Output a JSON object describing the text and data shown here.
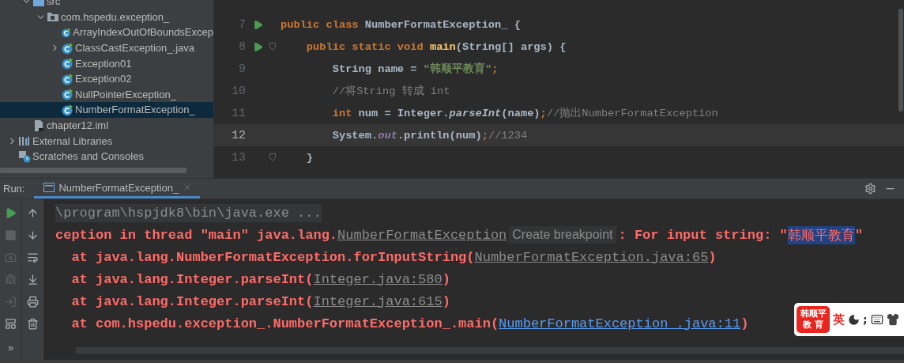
{
  "project_tree": {
    "module_items": [
      {
        "label": "src",
        "kind": "source-folder",
        "expanded": true,
        "children": [
          {
            "label": "com.hspedu.exception_",
            "kind": "package",
            "expanded": true,
            "children": [
              {
                "label": "ArrayIndexOutOfBoundsExcep",
                "kind": "class",
                "selected": false
              },
              {
                "label": "ClassCastException_.java",
                "kind": "class",
                "expanded": false,
                "selected": false
              },
              {
                "label": "Exception01",
                "kind": "class",
                "selected": false
              },
              {
                "label": "Exception02",
                "kind": "class",
                "selected": false
              },
              {
                "label": "NullPointerException_",
                "kind": "class",
                "selected": false
              },
              {
                "label": "NumberFormatException_",
                "kind": "class",
                "selected": true
              }
            ]
          }
        ]
      },
      {
        "label": "chapter12.iml",
        "kind": "iml"
      }
    ],
    "root_items": [
      {
        "label": "External Libraries",
        "kind": "libraries",
        "expanded": false
      },
      {
        "label": "Scratches and Consoles",
        "kind": "scratches"
      }
    ]
  },
  "editor": {
    "lines": [
      {
        "number": "7",
        "run": true,
        "current": false,
        "tokens": [
          {
            "kind": "keyword",
            "text": "public class "
          },
          {
            "kind": "plain",
            "text": "NumberFormatException_ {"
          }
        ]
      },
      {
        "number": "8",
        "run": true,
        "fold": true,
        "current": false,
        "tokens": [
          {
            "kind": "keyword",
            "text": "    public static void "
          },
          {
            "kind": "method",
            "text": "main"
          },
          {
            "kind": "plain",
            "text": "(String[] args) {"
          }
        ]
      },
      {
        "number": "9",
        "current": false,
        "tokens": [
          {
            "kind": "plain",
            "text": "        String name = "
          },
          {
            "kind": "string",
            "text": "\"韩顺平教育\""
          },
          {
            "kind": "keyword",
            "text": ";"
          }
        ]
      },
      {
        "number": "10",
        "current": false,
        "tokens": [
          {
            "kind": "comment",
            "text": "        //将String 转成 int"
          }
        ]
      },
      {
        "number": "11",
        "current": false,
        "tokens": [
          {
            "kind": "keyword",
            "text": "        int "
          },
          {
            "kind": "plain",
            "text": "num = Integer."
          },
          {
            "kind": "static-call",
            "text": "parseInt"
          },
          {
            "kind": "plain",
            "text": "(name)"
          },
          {
            "kind": "keyword",
            "text": ";"
          },
          {
            "kind": "comment",
            "text": "//抛出NumberFormatException"
          }
        ]
      },
      {
        "number": "12",
        "current": true,
        "tokens": [
          {
            "kind": "plain",
            "text": "        System."
          },
          {
            "kind": "static-field",
            "text": "out"
          },
          {
            "kind": "plain",
            "text": ".println(num)"
          },
          {
            "kind": "keyword",
            "text": ";"
          },
          {
            "kind": "comment",
            "text": "//1234"
          }
        ]
      },
      {
        "number": "13",
        "fold": true,
        "current": false,
        "tokens": [
          {
            "kind": "plain",
            "text": "    }"
          }
        ]
      }
    ]
  },
  "run_panel": {
    "label": "Run:",
    "tab": {
      "label": "NumberFormatException_",
      "selected": true
    },
    "left_tools": [
      {
        "kind": "run",
        "disabled": false
      },
      {
        "kind": "stop",
        "disabled": true
      },
      {
        "kind": "camera",
        "disabled": true
      },
      {
        "kind": "debug",
        "disabled": true
      },
      {
        "kind": "enter",
        "disabled": true
      },
      {
        "kind": "layout",
        "disabled": false
      }
    ],
    "more_label": "»",
    "right_tools": [
      {
        "kind": "up"
      },
      {
        "kind": "down"
      },
      {
        "kind": "wrap"
      },
      {
        "kind": "scroll-end"
      },
      {
        "kind": "print"
      },
      {
        "kind": "trash"
      }
    ],
    "console": [
      {
        "kind": "command",
        "segments": [
          {
            "kind": "text",
            "text": "\\program\\hspjdk8\\bin\\java.exe ..."
          }
        ]
      },
      {
        "kind": "error",
        "segments": [
          {
            "kind": "text",
            "text": "ception in thread \"main\" java.lang."
          },
          {
            "kind": "link",
            "text": "NumberFormatException"
          },
          {
            "kind": "hint",
            "text": "Create breakpoint"
          },
          {
            "kind": "text",
            "text": ": For input string: \""
          },
          {
            "kind": "selection",
            "text": "韩顺平教育"
          },
          {
            "kind": "text",
            "text": "\""
          }
        ]
      },
      {
        "kind": "error",
        "segments": [
          {
            "kind": "text",
            "text": "  at java.lang.NumberFormatException.forInputString("
          },
          {
            "kind": "link",
            "text": "NumberFormatException.java:65"
          },
          {
            "kind": "text",
            "text": ")"
          }
        ]
      },
      {
        "kind": "error",
        "segments": [
          {
            "kind": "text",
            "text": "  at java.lang.Integer.parseInt("
          },
          {
            "kind": "link",
            "text": "Integer.java:580"
          },
          {
            "kind": "text",
            "text": ")"
          }
        ]
      },
      {
        "kind": "error",
        "segments": [
          {
            "kind": "text",
            "text": "  at java.lang.Integer.parseInt("
          },
          {
            "kind": "link",
            "text": "Integer.java:615"
          },
          {
            "kind": "text",
            "text": ")"
          }
        ]
      },
      {
        "kind": "error",
        "segments": [
          {
            "kind": "text",
            "text": "  at com.hspedu.exception_.NumberFormatException_.main("
          },
          {
            "kind": "file-link",
            "text": "NumberFormatException_.java:11"
          },
          {
            "kind": "text",
            "text": ")"
          }
        ]
      }
    ]
  },
  "ime_bar": {
    "logo_lines": [
      "韩顺平",
      "教 育"
    ],
    "mode": "英",
    "punctuation": ";"
  }
}
